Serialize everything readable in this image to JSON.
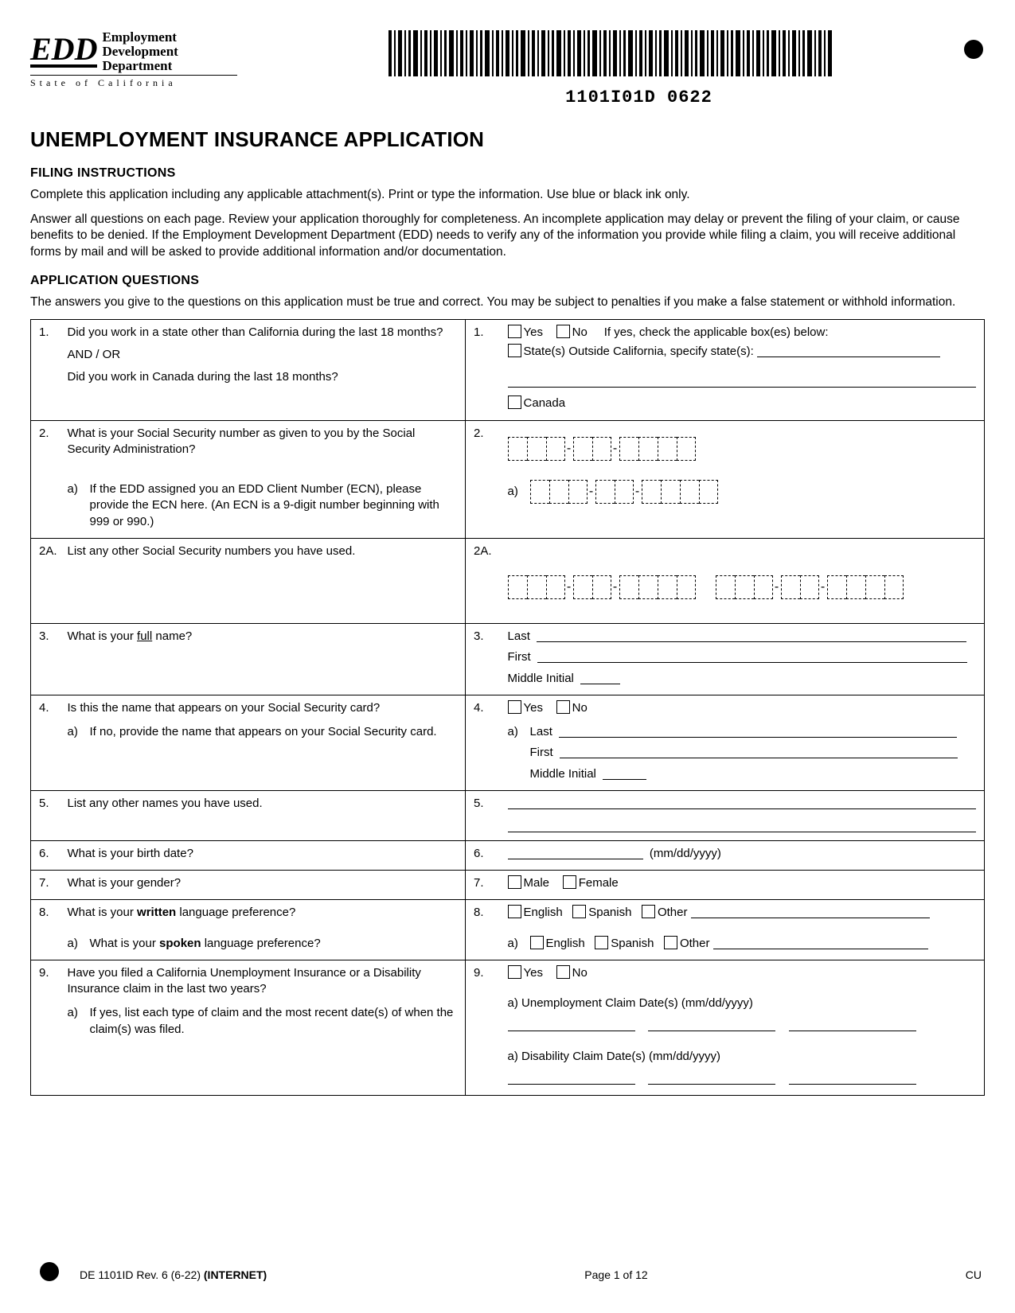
{
  "logo": {
    "mark": "EDD",
    "line1": "Employment",
    "line2": "Development",
    "line3": "Department",
    "state": "State of California"
  },
  "barcode_text": "1101I01D   0622",
  "title": "UNEMPLOYMENT INSURANCE APPLICATION",
  "filing": {
    "heading": "FILING INSTRUCTIONS",
    "p1": "Complete this application including any applicable attachment(s). Print or type the information. Use blue or black ink only.",
    "p2": "Answer all questions on each page. Review your application thoroughly for completeness. An incomplete application may delay or prevent the filing of your claim, or cause benefits to be denied. If the Employment Development Department (EDD) needs to verify any of the information you provide while filing a claim, you will receive additional forms by mail and will be asked to provide additional information and/or documentation."
  },
  "appq": {
    "heading": "APPLICATION QUESTIONS",
    "p": "The answers you give to the questions on this application must be true and correct. You may be subject to penalties if you make a false statement or withhold information."
  },
  "q": {
    "n1": "1.",
    "q1a": "Did you work in a state other than California during the last 18 months?",
    "q1_andor": "AND / OR",
    "q1b": "Did you work in Canada during the last 18 months?",
    "a1_yes": "Yes",
    "a1_no": "No",
    "a1_if": "If yes, check the applicable box(es) below:",
    "a1_states": "State(s) Outside California, specify state(s):",
    "a1_canada": "Canada",
    "n2": "2.",
    "q2": "What is your Social Security number as given to you by the Social Security Administration?",
    "q2a_n": "a)",
    "q2a": "If the EDD assigned you an EDD Client Number (ECN), please provide the ECN here. (An ECN is a 9-digit number beginning with 999 or 990.)",
    "n2A": "2A.",
    "q2A": "List any other Social Security numbers you have used.",
    "n3": "3.",
    "q3_pre": "What is your ",
    "q3_u": "full",
    "q3_post": " name?",
    "a3_last": "Last",
    "a3_first": "First",
    "a3_mi": "Middle Initial",
    "n4": "4.",
    "q4": "Is this the name that appears on your Social Security card?",
    "q4a_n": "a)",
    "q4a": "If no, provide the name that appears on your Social Security card.",
    "a4_yes": "Yes",
    "a4_no": "No",
    "a4a_n": "a)",
    "a4_last": "Last",
    "a4_first": "First",
    "a4_mi": "Middle Initial",
    "n5": "5.",
    "q5": "List any other names you have used.",
    "n6": "6.",
    "q6": "What is your birth date?",
    "a6_fmt": "(mm/dd/yyyy)",
    "n7": "7.",
    "q7": "What is your gender?",
    "a7_m": "Male",
    "a7_f": "Female",
    "n8": "8.",
    "q8_pre": "What is your ",
    "q8_b": "written",
    "q8_post": " language preference?",
    "q8a_n": "a)",
    "q8a_pre": "What is your ",
    "q8a_b": "spoken",
    "q8a_post": " language preference?",
    "a8_en": "English",
    "a8_es": "Spanish",
    "a8_ot": "Other",
    "n9": "9.",
    "q9": "Have you filed a California Unemployment Insurance or a Disability Insurance claim in the last two years?",
    "q9a_n": "a)",
    "q9a": "If yes, list each type of claim and the most recent date(s) of when the claim(s) was filed.",
    "a9_yes": "Yes",
    "a9_no": "No",
    "a9_u": "a)  Unemployment Claim Date(s) (mm/dd/yyyy)",
    "a9_d": "a)  Disability Claim Date(s) (mm/dd/yyyy)"
  },
  "footer": {
    "left_pre": "DE 1101ID Rev. 6 (6-22) ",
    "left_b": "(INTERNET)",
    "center": "Page 1 of 12",
    "right": "CU"
  }
}
